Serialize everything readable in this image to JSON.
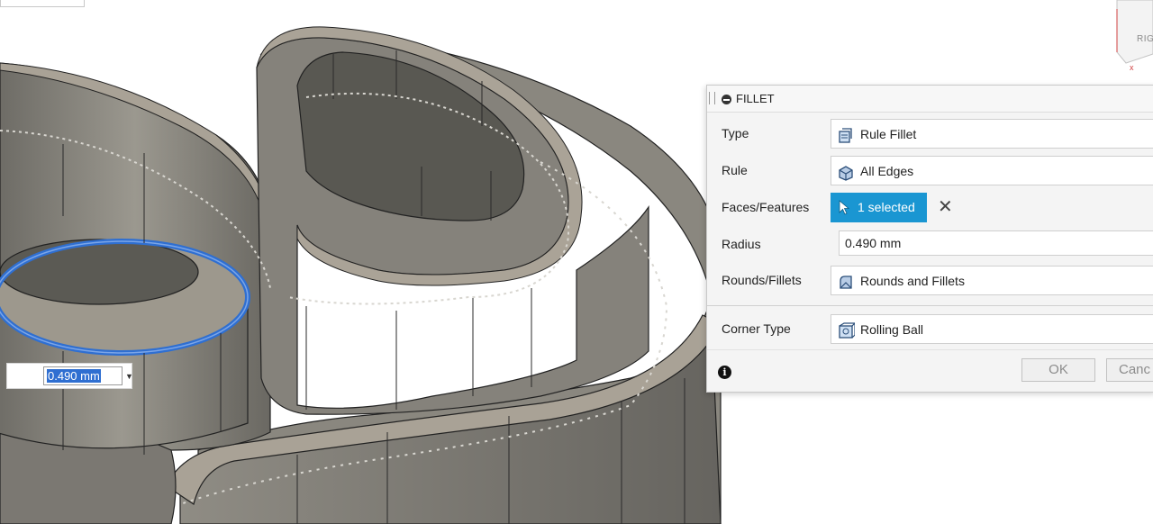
{
  "viewport": {
    "radius_input_value": "0.490 mm",
    "viewcube_label": "RIG"
  },
  "dialog": {
    "title": "FILLET",
    "rows": {
      "type": {
        "label": "Type",
        "value": "Rule Fillet",
        "icon": "rule-fillet-icon"
      },
      "rule": {
        "label": "Rule",
        "value": "All Edges",
        "icon": "all-edges-icon"
      },
      "faces": {
        "label": "Faces/Features",
        "value": "1 selected",
        "icon": "cursor-arrow-icon"
      },
      "radius": {
        "label": "Radius",
        "value": "0.490 mm"
      },
      "rounds": {
        "label": "Rounds/Fillets",
        "value": "Rounds and Fillets",
        "icon": "rounds-fillets-icon"
      },
      "corner": {
        "label": "Corner Type",
        "value": "Rolling Ball",
        "icon": "rolling-ball-icon"
      }
    },
    "ok_label": "OK",
    "cancel_label": "Canc",
    "colors": {
      "selection_button": "#1a96d2",
      "selection_highlight": "#2f6fd1",
      "model_fill": "#8a877f"
    }
  }
}
